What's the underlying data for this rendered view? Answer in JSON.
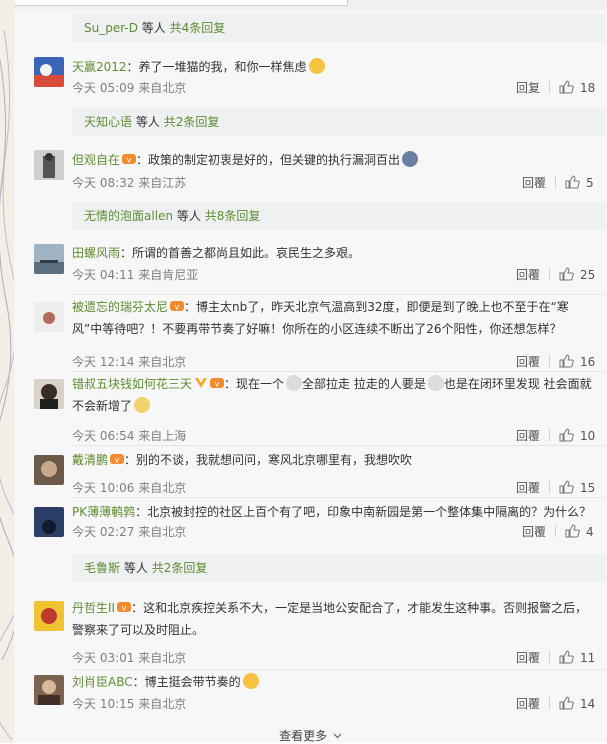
{
  "subs": [
    {
      "user": "Su_per-D",
      "mid": "等人",
      "count": "共4条回复"
    },
    {
      "user": "天知心语",
      "mid": "等人",
      "count": "共2条回复"
    },
    {
      "user": "无情的泡面allen",
      "mid": "等人",
      "count": "共8条回复"
    },
    {
      "user": "毛鲁斯",
      "mid": "等人",
      "count": "共2条回复"
    }
  ],
  "comments": [
    {
      "name": "天赢2012",
      "text": "：养了一堆猫的我，和你一样焦虑",
      "time": "今天 05:09 来自北京",
      "reply": "回复",
      "likes": "18"
    },
    {
      "name": "但观自在",
      "text": "：政策的制定初衷是好的，但关键的执行漏洞百出",
      "time": "今天 08:32 来自江苏",
      "reply": "回覆",
      "likes": "5"
    },
    {
      "name": "田螺风雨",
      "text": "：所谓的首善之都尚且如此。哀民生之多艰。",
      "time": "今天 04:11 来自肯尼亚",
      "reply": "回覆",
      "likes": "25"
    },
    {
      "name": "被遗忘的瑞芬太尼",
      "text": "：博主太nb了，昨天北京气温高到32度，即便是到了晚上也不至于在“寒风”中等待吧？！不要再带节奏了好嘛！你所在的小区连续不断出了26个阳性，你还想怎样？",
      "time": "今天 12:14 来自北京",
      "reply": "回覆",
      "likes": "16"
    },
    {
      "name": "错叔五块钱如何花三天",
      "text_a": "：现在一个",
      "text_b": "全部拉走 拉走的人要是",
      "text_c": "也是在闭环里发现 社会面就不会新增了",
      "time": "今天 06:54 来自上海",
      "reply": "回覆",
      "likes": "10"
    },
    {
      "name": "戴清鹏",
      "text": "：别的不谈，我就想问问，寒风北京哪里有，我想吹吹",
      "time": "今天 10:06 来自北京",
      "reply": "回覆",
      "likes": "15"
    },
    {
      "name": "PK薄薄鹌鹑",
      "text": "：北京被封控的社区上百个有了吧，印象中南新园是第一个整体集中隔离的？为什么？",
      "time": "今天 02:27 来自北京",
      "reply": "回覆",
      "likes": "4"
    },
    {
      "name": "丹哲生II",
      "text": "：这和北京疾控关系不大，一定是当地公安配合了，才能发生这种事。否则报警之后，警察来了可以及时阻止。",
      "time": "今天 03:01 来自北京",
      "reply": "回覆",
      "likes": "11"
    },
    {
      "name": "刘肖臣ABC",
      "text": "：博主挺会带节奏的",
      "time": "今天 10:15 来自北京",
      "reply": "回覆",
      "likes": "14"
    }
  ],
  "see_more": "查看更多",
  "icons": {
    "like": "thumb-up-icon",
    "chevron": "chevron-down-icon"
  },
  "colors": {
    "username": "#5f8c31",
    "meta": "#808080",
    "sub_bg": "#eef0f2"
  }
}
